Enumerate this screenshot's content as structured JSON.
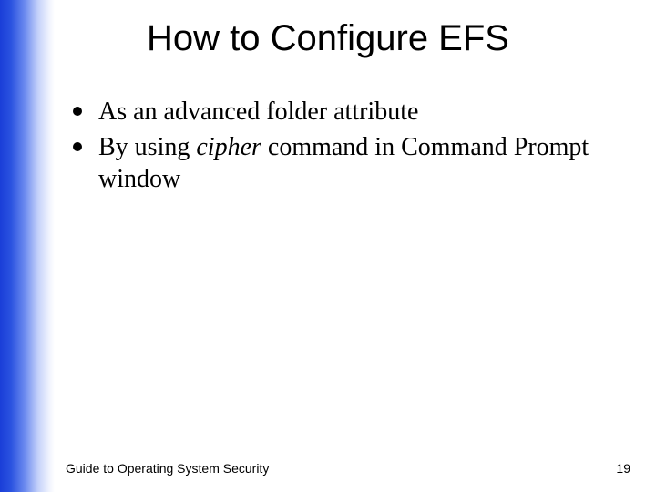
{
  "slide": {
    "title": "How to Configure EFS",
    "bullets": [
      {
        "text_plain": "As an advanced folder attribute"
      },
      {
        "text_before": "By using ",
        "text_italic": "cipher",
        "text_after": " command in Command Prompt window"
      }
    ],
    "footer": {
      "source": "Guide to Operating System Security",
      "page_number": "19"
    }
  }
}
